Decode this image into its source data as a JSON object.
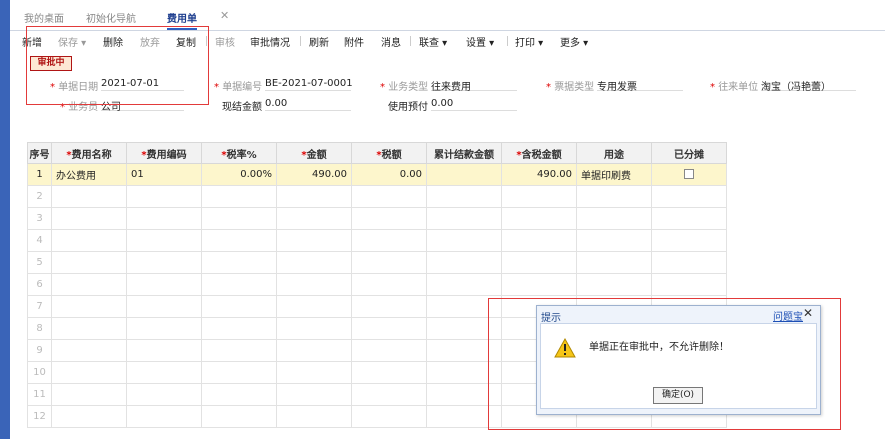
{
  "tabs": [
    {
      "label": "我的桌面"
    },
    {
      "label": "初始化导航"
    },
    {
      "label": "费用单"
    }
  ],
  "toolbar": [
    {
      "label": "新增"
    },
    {
      "label": "保存 ▾"
    },
    {
      "label": "删除"
    },
    {
      "label": "放弃"
    },
    {
      "label": "复制"
    },
    {
      "label": "审核"
    },
    {
      "label": "审批情况"
    },
    {
      "label": "刷新"
    },
    {
      "label": "附件"
    },
    {
      "label": "消息"
    },
    {
      "label": "联查 ▾"
    },
    {
      "label": "设置 ▾"
    },
    {
      "label": "打印 ▾"
    },
    {
      "label": "更多 ▾"
    }
  ],
  "status_badge": "审批中",
  "form": {
    "date": {
      "label": "单据日期",
      "value": "2021-07-01"
    },
    "doc_no": {
      "label": "单据编号",
      "value": "BE-2021-07-0001"
    },
    "biz_type": {
      "label": "业务类型",
      "value": "往来费用"
    },
    "invoice_type": {
      "label": "票据类型",
      "value": "专用发票"
    },
    "partner": {
      "label": "往来单位",
      "value": "淘宝（冯艳蕾）"
    },
    "salesman": {
      "label": "业务员",
      "value": "公司"
    },
    "cash_amount": {
      "label": "现结金额",
      "value": "0.00"
    },
    "prepaid": {
      "label": "使用预付",
      "value": "0.00"
    }
  },
  "table": {
    "headers": [
      "序号",
      "费用名称",
      "费用编码",
      "税率%",
      "金额",
      "税额",
      "累计结款金额",
      "含税金额",
      "用途",
      "已分摊"
    ],
    "rows": [
      {
        "no": "1",
        "name": "办公费用",
        "code": "01",
        "rate": "0.00%",
        "amount": "490.00",
        "tax": "0.00",
        "settled": "",
        "total": "490.00",
        "purpose": "单据印刷费"
      },
      {
        "no": "2"
      },
      {
        "no": "3"
      },
      {
        "no": "4"
      },
      {
        "no": "5"
      },
      {
        "no": "6"
      },
      {
        "no": "7"
      },
      {
        "no": "8"
      },
      {
        "no": "9"
      },
      {
        "no": "10"
      },
      {
        "no": "11"
      },
      {
        "no": "12"
      }
    ]
  },
  "dialog": {
    "title": "提示",
    "help_link": "问题宝",
    "message": "单据正在审批中，不允许删除！",
    "ok_button": "确定(O)"
  }
}
